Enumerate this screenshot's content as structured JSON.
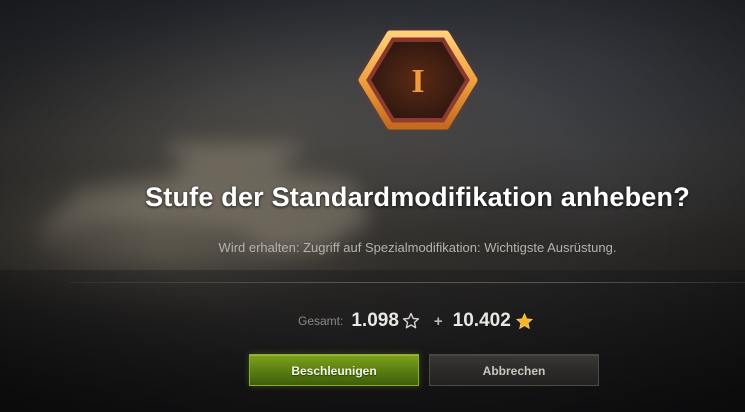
{
  "dialog": {
    "emblem_numeral": "I",
    "title": "Stufe der Standardmodifikation anheben?",
    "description": "Wird erhalten: Zugriff auf Spezialmodifikation: Wichtigste Ausrüstung."
  },
  "cost": {
    "label": "Gesamt:",
    "free_xp_value": "1.098",
    "free_xp_icon": "outline-star-icon",
    "plus": "+",
    "xp_value": "10.402",
    "xp_icon": "gold-star-icon"
  },
  "buttons": {
    "accelerate_label": "Beschleunigen",
    "cancel_label": "Abbrechen"
  },
  "colors": {
    "emblem_orange": "#f0a040",
    "emblem_glow": "#d8401a",
    "accent_green": "#5c8112",
    "title_text": "#ffffff",
    "gold_star": "#f6b625"
  }
}
